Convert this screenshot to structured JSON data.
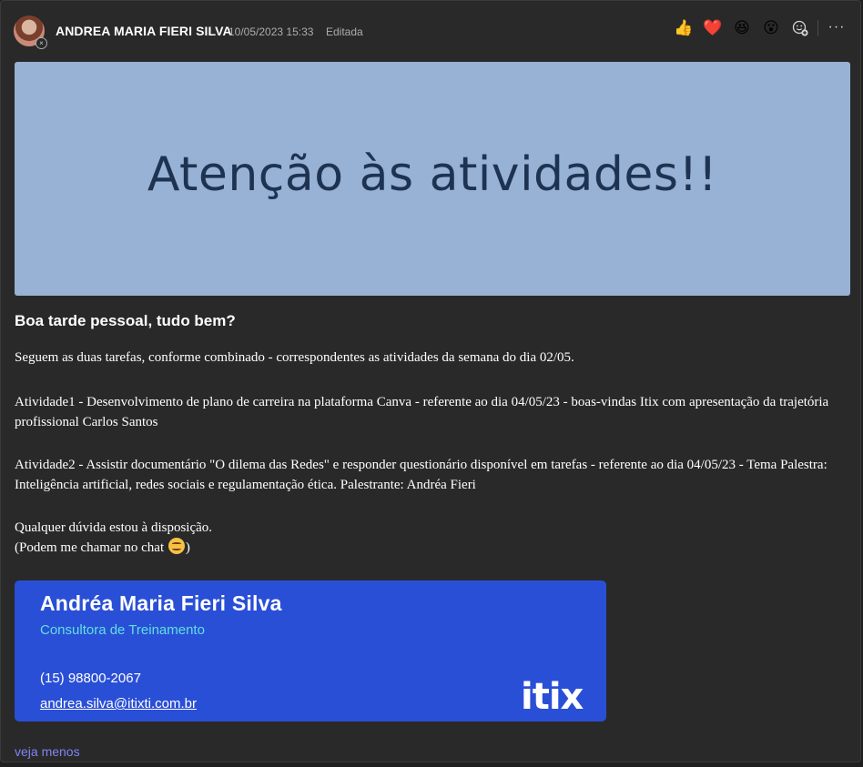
{
  "post": {
    "author": "ANDREA MARIA FIERI SILVA",
    "timestamp": "10/05/2023 15:33",
    "edited_label": "Editada",
    "reactions": [
      {
        "name": "like-reaction",
        "glyph": "👍"
      },
      {
        "name": "heart-reaction",
        "glyph": "❤️"
      },
      {
        "name": "laugh-reaction",
        "glyph": "😆"
      },
      {
        "name": "surprised-reaction",
        "glyph": "😮"
      },
      {
        "name": "add-reaction",
        "glyph": "☺"
      }
    ],
    "more_options": "···"
  },
  "banner": {
    "text": "Atenção às atividades!!"
  },
  "message": {
    "subject": "Boa tarde pessoal, tudo bem?",
    "paragraph1": "Seguem as duas tarefas, conforme combinado - correspondentes as atividades da semana do dia 02/05.",
    "paragraph2": "Atividade1 - Desenvolvimento de plano de carreira na plataforma Canva - referente ao dia 04/05/23 - boas-vindas Itix com apresentação da trajetória profissional Carlos Santos",
    "paragraph3": "Atividade2 - Assistir documentário \"O dilema das Redes\" e responder questionário disponível em tarefas - referente ao dia 04/05/23 - Tema Palestra: Inteligência artificial, redes sociais e regulamentação ética. Palestrante: Andréa Fieri",
    "paragraph4": "Qualquer dúvida estou à disposição.",
    "paragraph5_before": "(Podem me chamar no chat ",
    "paragraph5_after": ")"
  },
  "signature": {
    "name": "Andréa Maria Fieri Silva",
    "role": "Consultora de Treinamento",
    "phone": "(15) 98800-2067",
    "email": "andrea.silva@itixti.com.br",
    "logo": "itix"
  },
  "footer": {
    "see_less": "veja menos"
  },
  "colors": {
    "background": "#292929",
    "banner": "#98b2d5",
    "banner_text": "#1e3352",
    "signature": "#2a4fd7",
    "signature_role": "#5fe0e0",
    "link": "#7f85f5"
  }
}
